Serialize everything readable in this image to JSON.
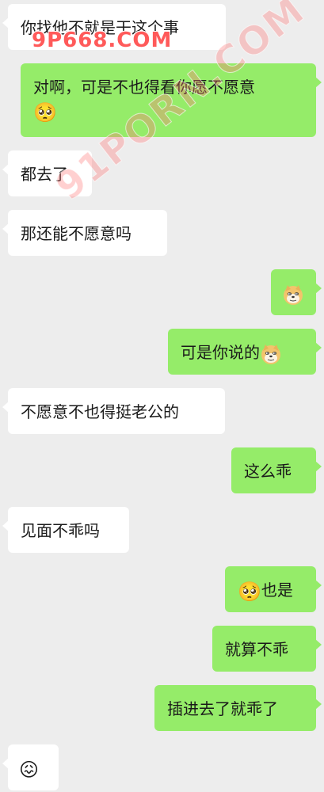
{
  "messages": [
    {
      "side": "in",
      "text": "你找他不就是干这个事"
    },
    {
      "side": "out",
      "line1": "对啊，可是不也得看你愿不愿意",
      "emoji": "🥺"
    },
    {
      "side": "in",
      "text": "都去了"
    },
    {
      "side": "in",
      "text": "那还能不愿意吗"
    },
    {
      "side": "out",
      "sticker": "doge-icon"
    },
    {
      "side": "out",
      "text": "可是你说的",
      "sticker": "doge-icon"
    },
    {
      "side": "in",
      "text": "不愿意不也得挺老公的"
    },
    {
      "side": "out",
      "text": "这么乖"
    },
    {
      "side": "in",
      "text": "见面不乖吗"
    },
    {
      "side": "out",
      "emoji": "🥺",
      "text": "也是"
    },
    {
      "side": "out",
      "text": "就算不乖"
    },
    {
      "side": "out",
      "text": "插进去了就乖了"
    },
    {
      "side": "in",
      "emoji": "😖"
    }
  ],
  "watermarks": {
    "top": "9P668.COM",
    "diagonal": "91PORN.COM"
  },
  "colors": {
    "background": "#ededed",
    "incoming_bubble": "#ffffff",
    "outgoing_bubble": "#95ec69"
  }
}
